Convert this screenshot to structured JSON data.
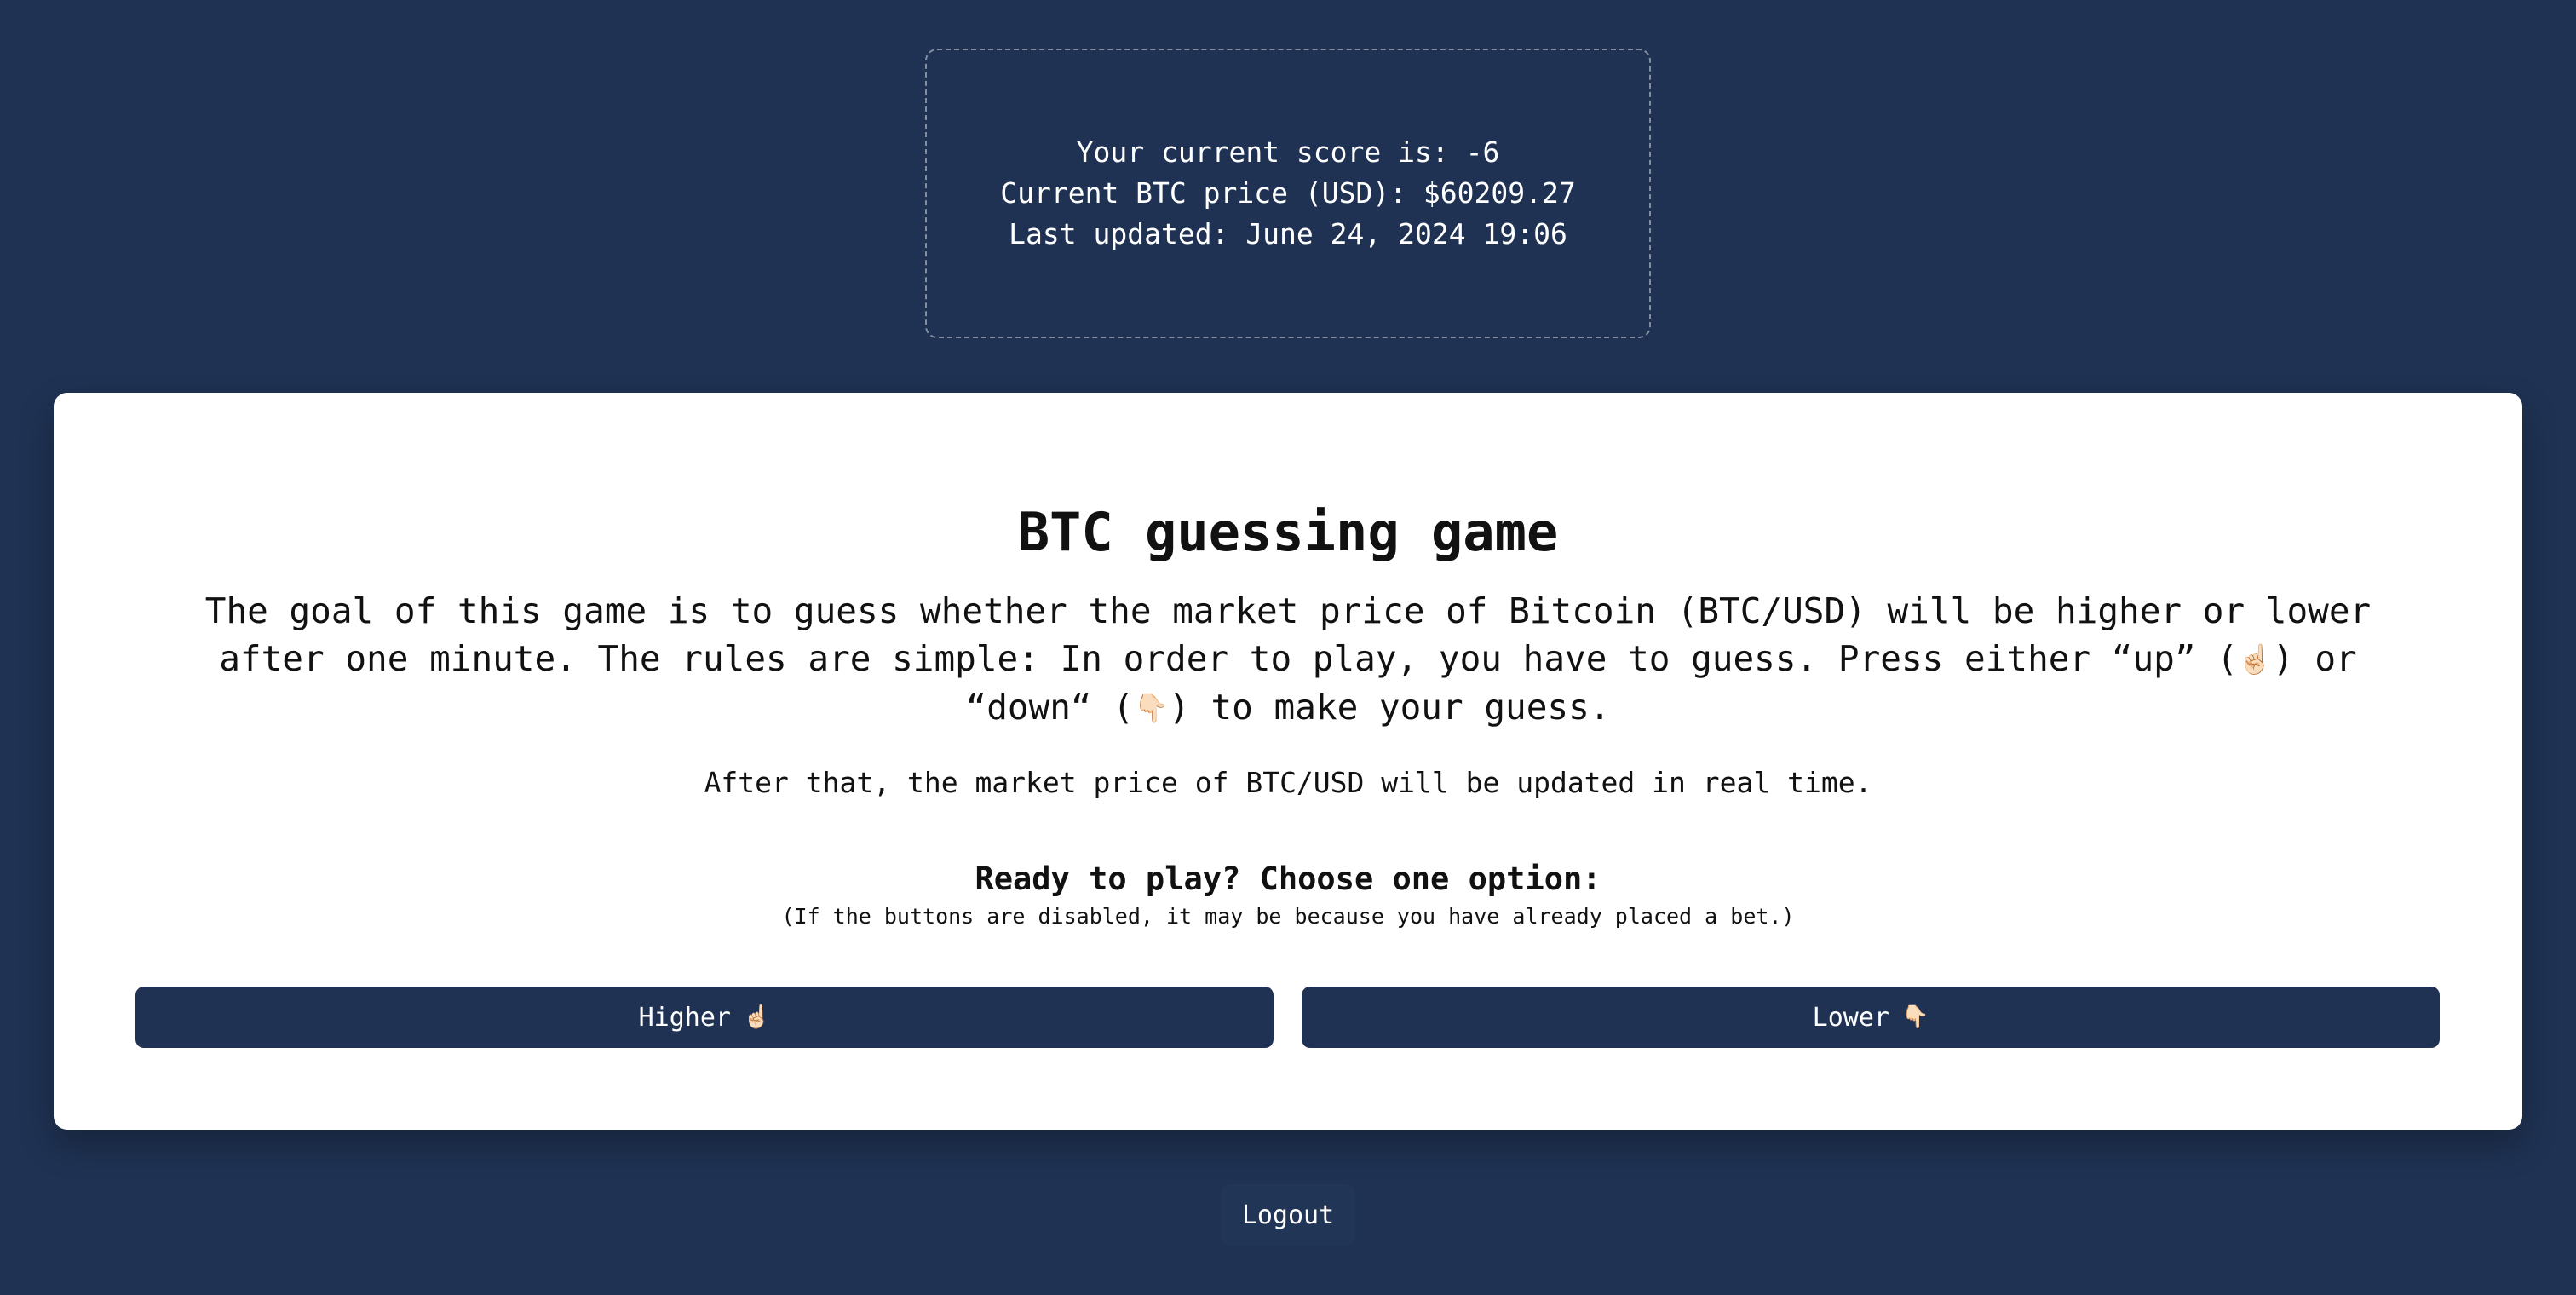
{
  "status": {
    "score_line": "Your current score is: -6",
    "price_line": "Current BTC price (USD): $60209.27",
    "updated_line": "Last updated: June 24, 2024 19:06"
  },
  "game": {
    "title": "BTC guessing game",
    "intro_part1": "The goal of this game is to guess whether the market price of Bitcoin (BTC/USD) will be higher or lower after one minute. The rules are simple: In order to play, you have to guess. Press either “up” (",
    "intro_emoji_up": "☝🏻",
    "intro_part2": ") or “down“ (",
    "intro_emoji_down": "👇🏻",
    "intro_part3": ") to make your guess.",
    "update_note": "After that, the market price of BTC/USD will be updated in real time.",
    "ready_heading": "Ready to play? Choose one option:",
    "disabled_note": "(If the buttons are disabled, it may be because you have already placed a bet.)"
  },
  "buttons": {
    "higher_label": "Higher",
    "higher_emoji": "☝🏻",
    "lower_label": "Lower",
    "lower_emoji": "👇🏻",
    "logout_label": "Logout"
  },
  "colors": {
    "background": "#1f3253",
    "card": "#ffffff",
    "button": "#1f3253"
  }
}
